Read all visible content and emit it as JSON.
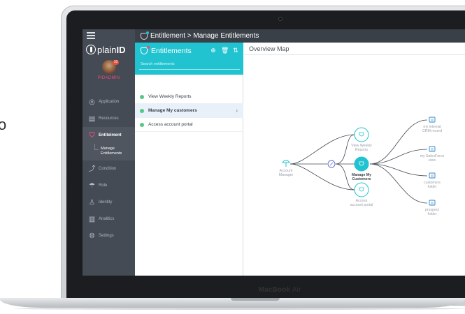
{
  "stray_text": "o",
  "device": {
    "brand_bold": "MacBook",
    "brand_light": "Air"
  },
  "topbar": {
    "title": "Entitlement > Manage Entitlements"
  },
  "sidebar": {
    "logo_light": "plain",
    "logo_bold": "ID",
    "user": {
      "name": "PIDADMIN",
      "badge": "10"
    },
    "items": [
      {
        "label": "Application",
        "icon": "globe-icon",
        "glyph": "◎"
      },
      {
        "label": "Resources",
        "icon": "folder-icon",
        "glyph": "▤"
      },
      {
        "label": "Entitelment",
        "icon": "shield-icon",
        "glyph": "⛉",
        "active": true
      },
      {
        "label": "Manage Entitlements",
        "sub": true
      },
      {
        "label": "Condition",
        "icon": "condition-icon",
        "glyph": "⤴"
      },
      {
        "label": "Role",
        "icon": "umbrella-icon",
        "glyph": "☂"
      },
      {
        "label": "Identity",
        "icon": "users-icon",
        "glyph": "♙"
      },
      {
        "label": "Analitics",
        "icon": "bar-chart-icon",
        "glyph": "▥"
      },
      {
        "label": "Settings",
        "icon": "gear-icon",
        "glyph": "⚙"
      }
    ]
  },
  "entitlements_panel": {
    "title": "Entitlements",
    "actions": {
      "add": "⊕",
      "delete": "🗑",
      "sort": "⇅"
    },
    "search_placeholder": "Search entitlements",
    "items": [
      {
        "label": "View Weekly Reports",
        "selected": false
      },
      {
        "label": "Manage My customers",
        "selected": true
      },
      {
        "label": "Access account portal",
        "selected": false
      }
    ]
  },
  "overview": {
    "title": "Overview Map",
    "colors": {
      "accent": "#21c3d0",
      "line": "#3f4650",
      "role": "#21c3d0",
      "resource": "#2f87c7"
    },
    "role_label": "Account Manager",
    "condition_icon": "shield-small-icon",
    "entitlements": [
      {
        "label": "View Weekly Reports",
        "selected": false
      },
      {
        "label": "Manage My Customers",
        "selected": true
      },
      {
        "label": "Access account portal",
        "selected": false
      }
    ],
    "resources": [
      {
        "label": "my internal CRM record",
        "icon": "crm-record-icon"
      },
      {
        "label": "my SalesForce view",
        "icon": "salesforce-icon"
      },
      {
        "label": "customers folder",
        "icon": "folder-icon"
      },
      {
        "label": "prospect folder",
        "icon": "folder-icon"
      }
    ]
  }
}
